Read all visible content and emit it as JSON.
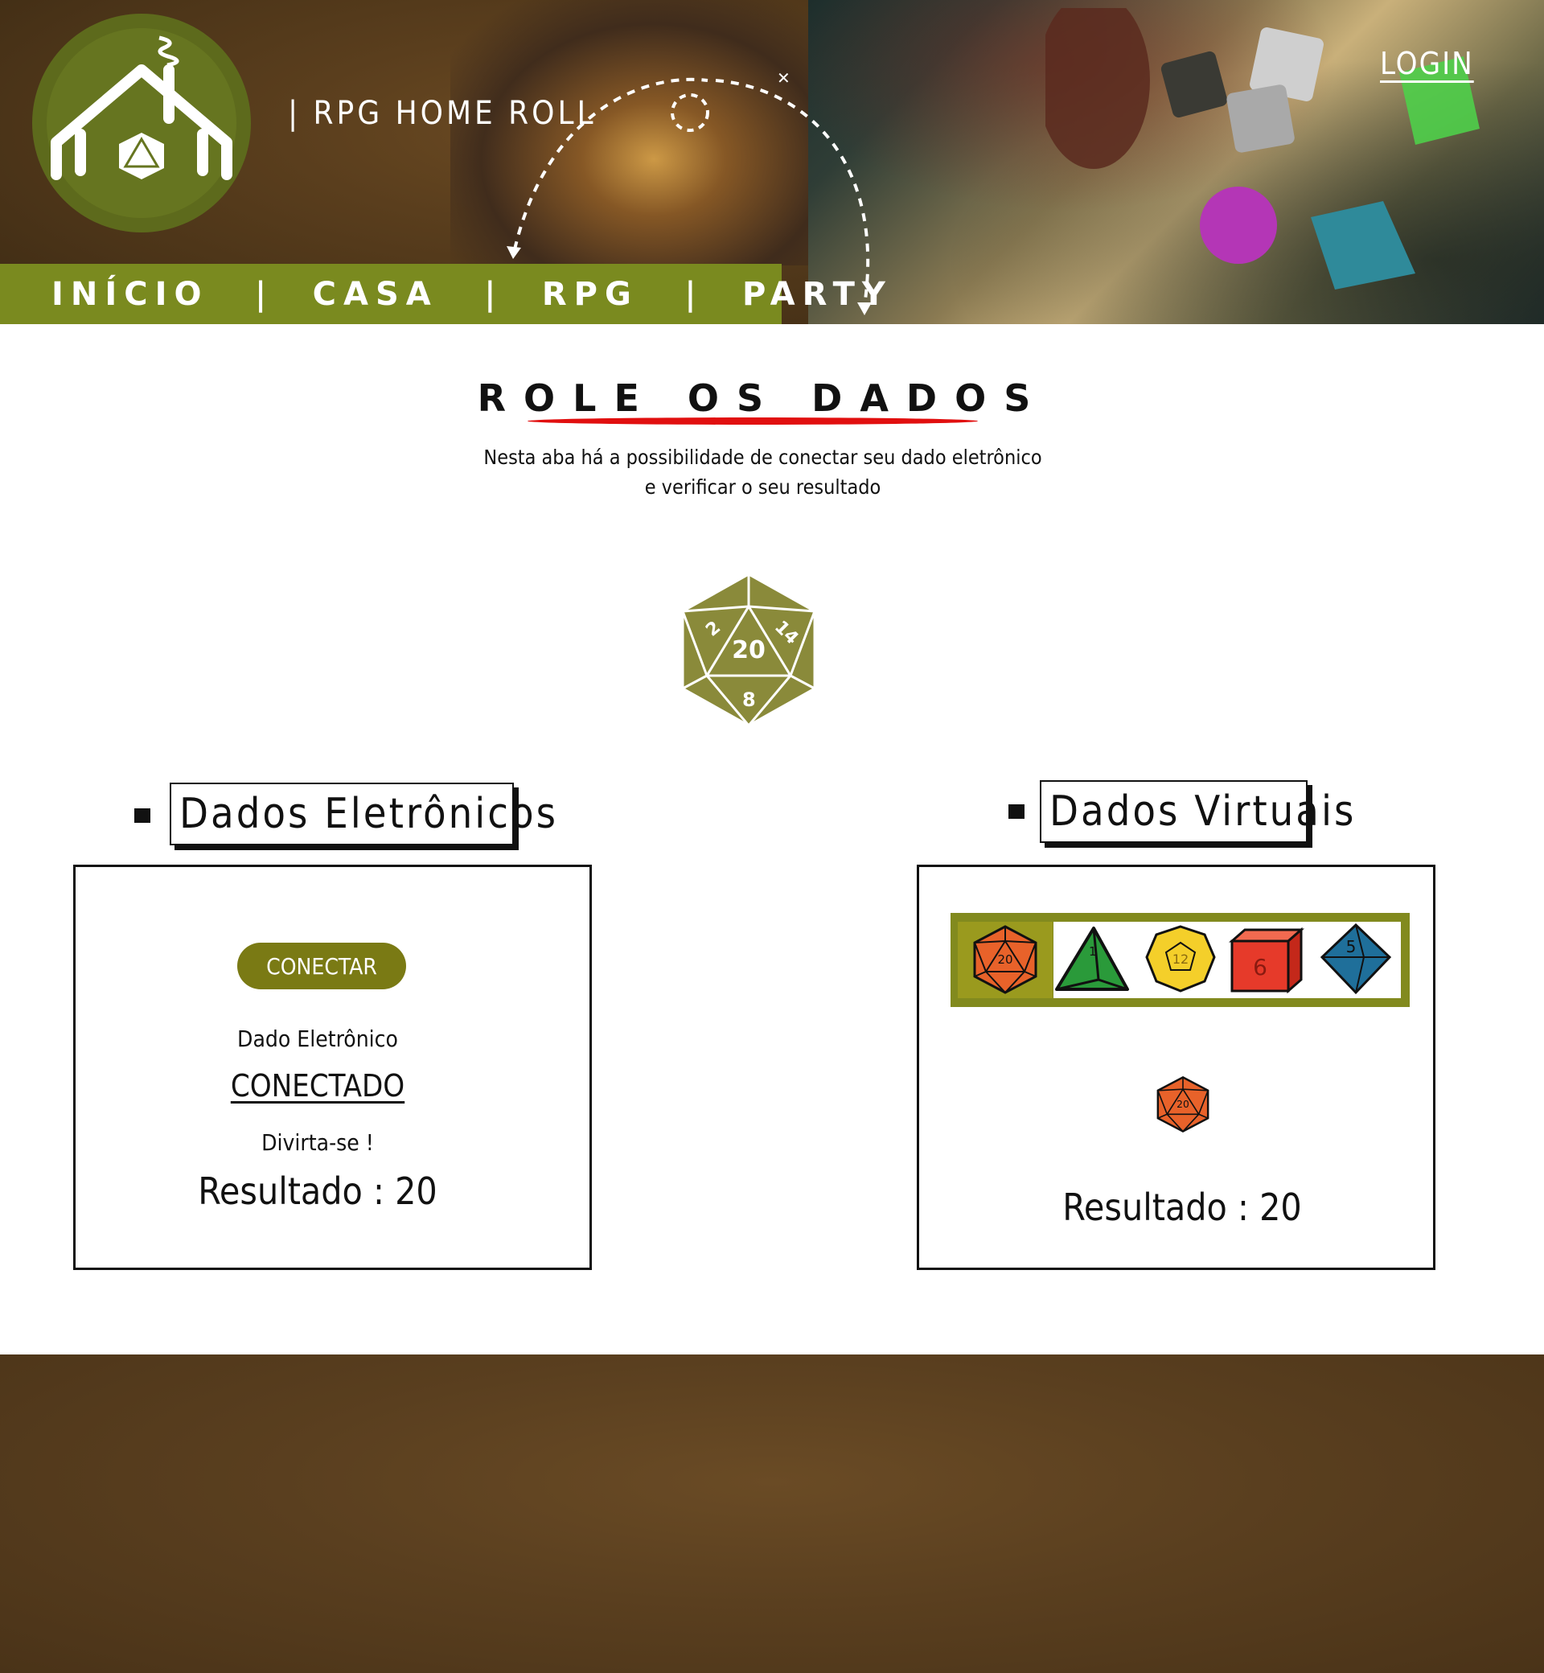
{
  "header": {
    "brand": "| RPG HOME ROLL",
    "login": "LOGIN",
    "logo": "house-d20-logo",
    "nav": [
      "INÍCIO",
      "CASA",
      "RPG",
      "PARTY"
    ],
    "separator": "|"
  },
  "hero": {
    "title": "ROLE OS DADOS",
    "description_line1": "Nesta aba há a possibilidade de conectar seu dado eletrônico",
    "description_line2": "e verificar o seu resultado",
    "die_number": "20"
  },
  "electronic": {
    "title": "Dados Eletrônicos",
    "button": "CONECTAR",
    "device_label": "Dado Eletrônico",
    "status": "CONECTADO",
    "greeting": "Divirta-se !",
    "result": "Resultado : 20"
  },
  "virtual": {
    "title": "Dados Virtuais",
    "dice": [
      {
        "name": "d20",
        "number": "20",
        "color": "#e8622a",
        "selected": true
      },
      {
        "name": "d4",
        "number": "1",
        "color": "#2a9a3a",
        "selected": false
      },
      {
        "name": "d12",
        "number": "12",
        "color": "#f4cf2a",
        "selected": false
      },
      {
        "name": "d6",
        "number": "6",
        "color": "#e63a2a",
        "selected": false
      },
      {
        "name": "d8",
        "number": "5",
        "color": "#1f6f9a",
        "selected": false
      }
    ],
    "rolled_die": "20",
    "result": "Resultado : 20"
  },
  "colors": {
    "olive": "#7a8a1f",
    "accent_red": "#e10f0f",
    "brown": "#5a3f1f"
  }
}
